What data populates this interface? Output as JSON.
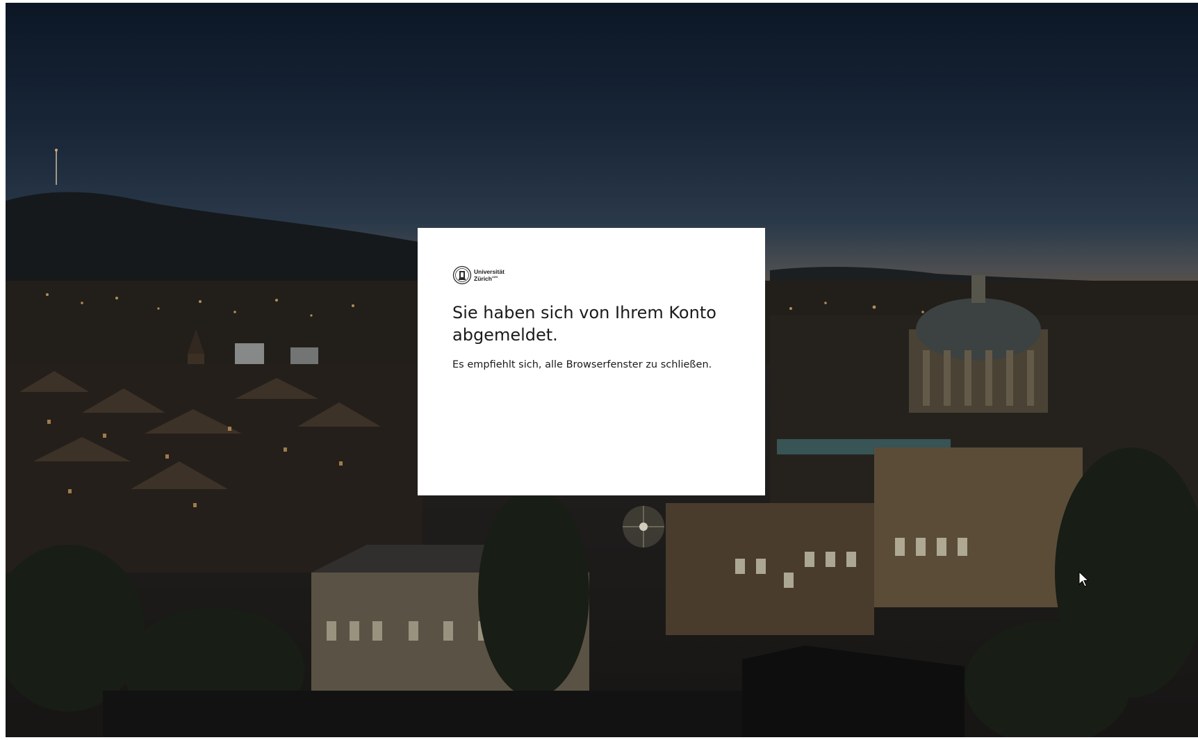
{
  "logo": {
    "line1": "Universität",
    "line2": "Zürich",
    "line2_mark": "UZH"
  },
  "dialog": {
    "title": "Sie haben sich von Ihrem Konto abgemeldet.",
    "message": "Es empfiehlt sich, alle Browserfenster zu schließen."
  },
  "icons": {
    "logo": "university-seal-icon",
    "cursor": "mouse-pointer-icon"
  },
  "colors": {
    "dialog_background": "#ffffff",
    "text": "#1b1b1b",
    "sky_top": "#0f1c2e",
    "horizon": "#7a6551"
  }
}
